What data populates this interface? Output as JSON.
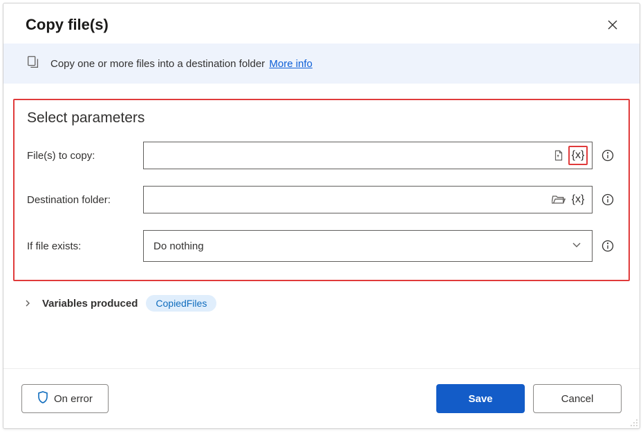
{
  "dialog": {
    "title": "Copy file(s)"
  },
  "banner": {
    "text": "Copy one or more files into a destination folder",
    "more_info": "More info"
  },
  "params": {
    "heading": "Select parameters",
    "files_to_copy": {
      "label": "File(s) to copy:",
      "value": "",
      "var_symbol": "{x}"
    },
    "destination_folder": {
      "label": "Destination folder:",
      "value": "",
      "var_symbol": "{x}"
    },
    "if_file_exists": {
      "label": "If file exists:",
      "selected": "Do nothing"
    }
  },
  "variables_produced": {
    "label": "Variables produced",
    "chip": "CopiedFiles"
  },
  "footer": {
    "on_error": "On error",
    "save": "Save",
    "cancel": "Cancel"
  }
}
